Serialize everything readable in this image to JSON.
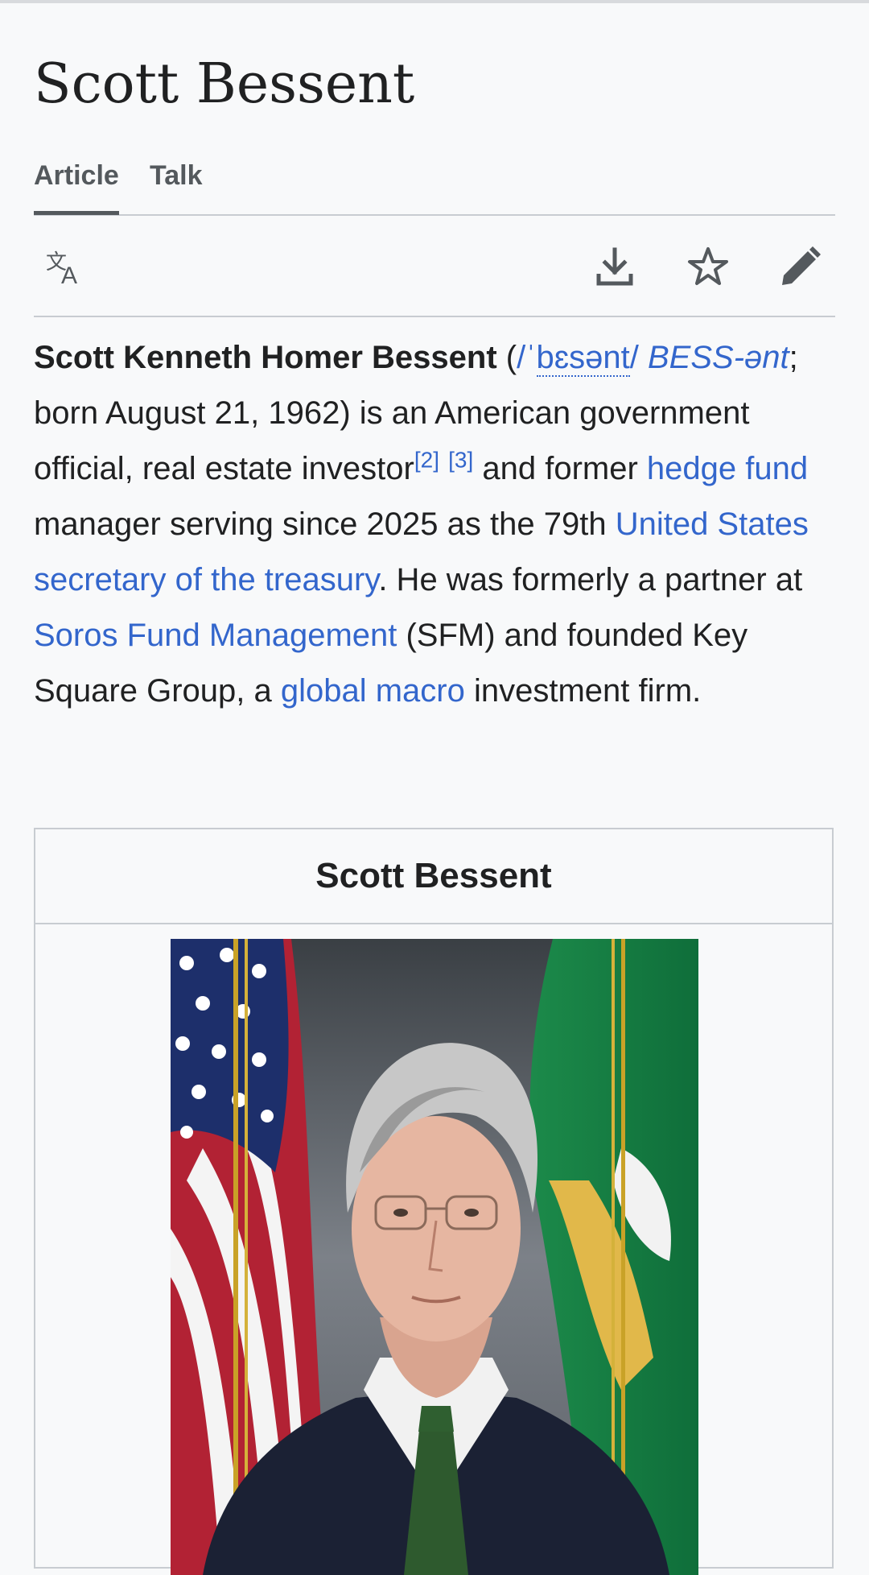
{
  "page": {
    "title": "Scott Bessent"
  },
  "tabs": [
    {
      "label": "Article",
      "active": true
    },
    {
      "label": "Talk",
      "active": false
    }
  ],
  "toolbar": {
    "language_icon": "language-icon",
    "download_icon": "download-icon",
    "watch_icon": "star-icon",
    "edit_icon": "pencil-icon"
  },
  "lead": {
    "name": "Scott Kenneth Homer Bessent",
    "open_paren": " (",
    "ipa_1": "/ˈ",
    "ipa_2": "bɛsənt",
    "ipa_3": "/",
    "respell": "BESS",
    "respell_2": "-ənt",
    "t1": "; born August 21, 1962) is an American government official, real estate investor",
    "ref2": "[2]",
    "ref3": "[3]",
    "t2": " and former ",
    "link_hedge_fund": "hedge fund",
    "t3": " manager serving since 2025 as the 79th ",
    "link_treasury": "United States secretary of the treasury",
    "t4": ". He was formerly a partner at ",
    "link_soros": "Soros Fund Management",
    "t5": " (SFM) and founded Key Square Group, a ",
    "link_macro": "global macro",
    "t6": " investment firm."
  },
  "infobox": {
    "title": "Scott Bessent",
    "image_subject": "official-portrait"
  },
  "colors": {
    "link": "#3366cc",
    "text": "#202122",
    "border": "#c8ccd1",
    "background": "#f8f9fa"
  }
}
